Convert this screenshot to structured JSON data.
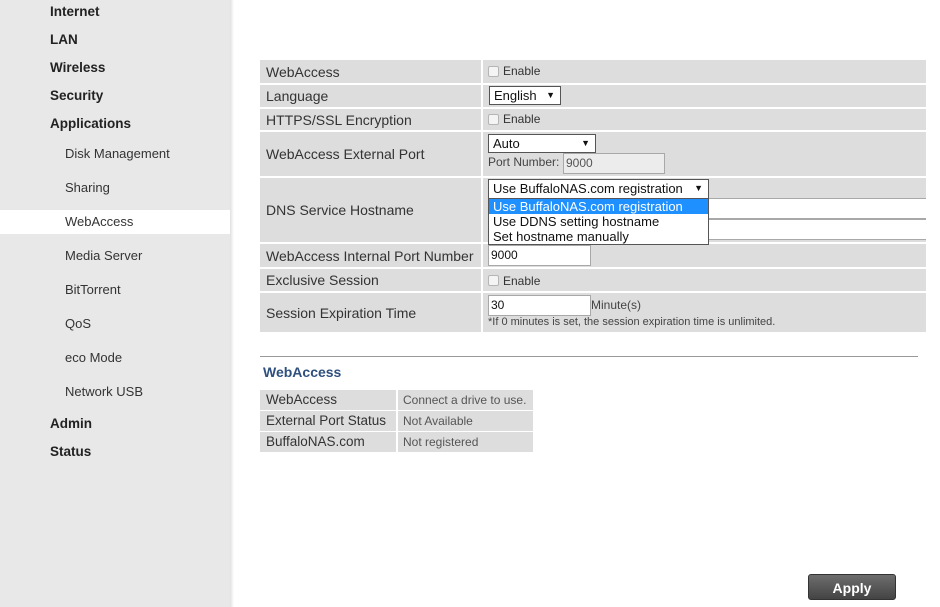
{
  "sidebar": {
    "top_items": [
      {
        "label": "Internet"
      },
      {
        "label": "LAN"
      },
      {
        "label": "Wireless"
      },
      {
        "label": "Security"
      },
      {
        "label": "Applications"
      }
    ],
    "sub_items": [
      {
        "label": "Disk Management"
      },
      {
        "label": "Sharing"
      },
      {
        "label": "WebAccess",
        "active": true
      },
      {
        "label": "Media Server"
      },
      {
        "label": "BitTorrent"
      },
      {
        "label": "QoS"
      },
      {
        "label": "eco Mode"
      },
      {
        "label": "Network USB"
      }
    ],
    "bottom_items": [
      {
        "label": "Admin"
      },
      {
        "label": "Status"
      }
    ]
  },
  "form": {
    "webaccess": {
      "label": "WebAccess",
      "checkbox_label": "Enable",
      "checked": false
    },
    "language": {
      "label": "Language",
      "selected": "English"
    },
    "https": {
      "label": "HTTPS/SSL Encryption",
      "checkbox_label": "Enable",
      "checked": false
    },
    "external_port": {
      "label": "WebAccess External Port",
      "selected": "Auto",
      "port_number_label": "Port Number:",
      "port_number_value": "9000"
    },
    "dns": {
      "label": "DNS Service Hostname",
      "selected": "Use BuffaloNAS.com registration",
      "options": [
        "Use BuffaloNAS.com registration",
        "Use DDNS setting hostname",
        "Set hostname manually"
      ]
    },
    "internal_port": {
      "label": "WebAccess Internal Port Number",
      "value": "9000"
    },
    "exclusive": {
      "label": "Exclusive Session",
      "checkbox_label": "Enable",
      "checked": false
    },
    "expiration": {
      "label": "Session Expiration Time",
      "value": "30",
      "unit": "Minute(s)",
      "note": "*If 0 minutes is set, the session expiration time is unlimited."
    }
  },
  "status_section": {
    "title": "WebAccess",
    "rows": [
      {
        "label": "WebAccess",
        "value": "Connect a drive to use."
      },
      {
        "label": "External Port Status",
        "value": "Not Available"
      },
      {
        "label": "BuffaloNAS.com",
        "value": "Not registered"
      }
    ]
  },
  "apply_label": "Apply"
}
